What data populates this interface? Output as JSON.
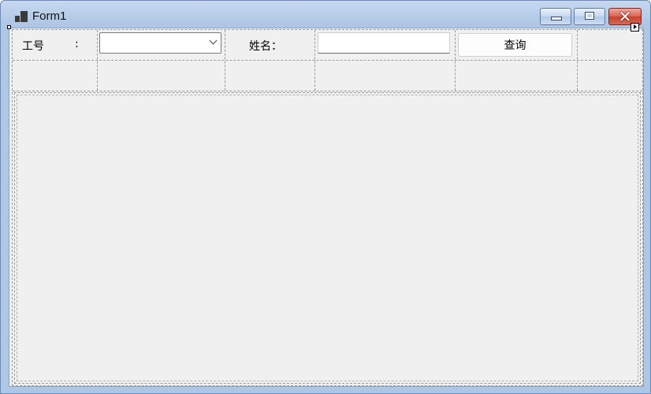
{
  "window": {
    "title": "Form1",
    "controls": [
      "minimize-icon",
      "maximize-icon",
      "close-icon"
    ]
  },
  "form": {
    "employee_id_label": "工号",
    "employee_id_colon": ":",
    "employee_id_value": "",
    "name_label": "姓名：",
    "name_value": "",
    "query_button": "查询"
  },
  "colors": {
    "client_bg": "#f0f0f0",
    "titlebar": "#aec7e5",
    "close_button": "#c7402c"
  }
}
